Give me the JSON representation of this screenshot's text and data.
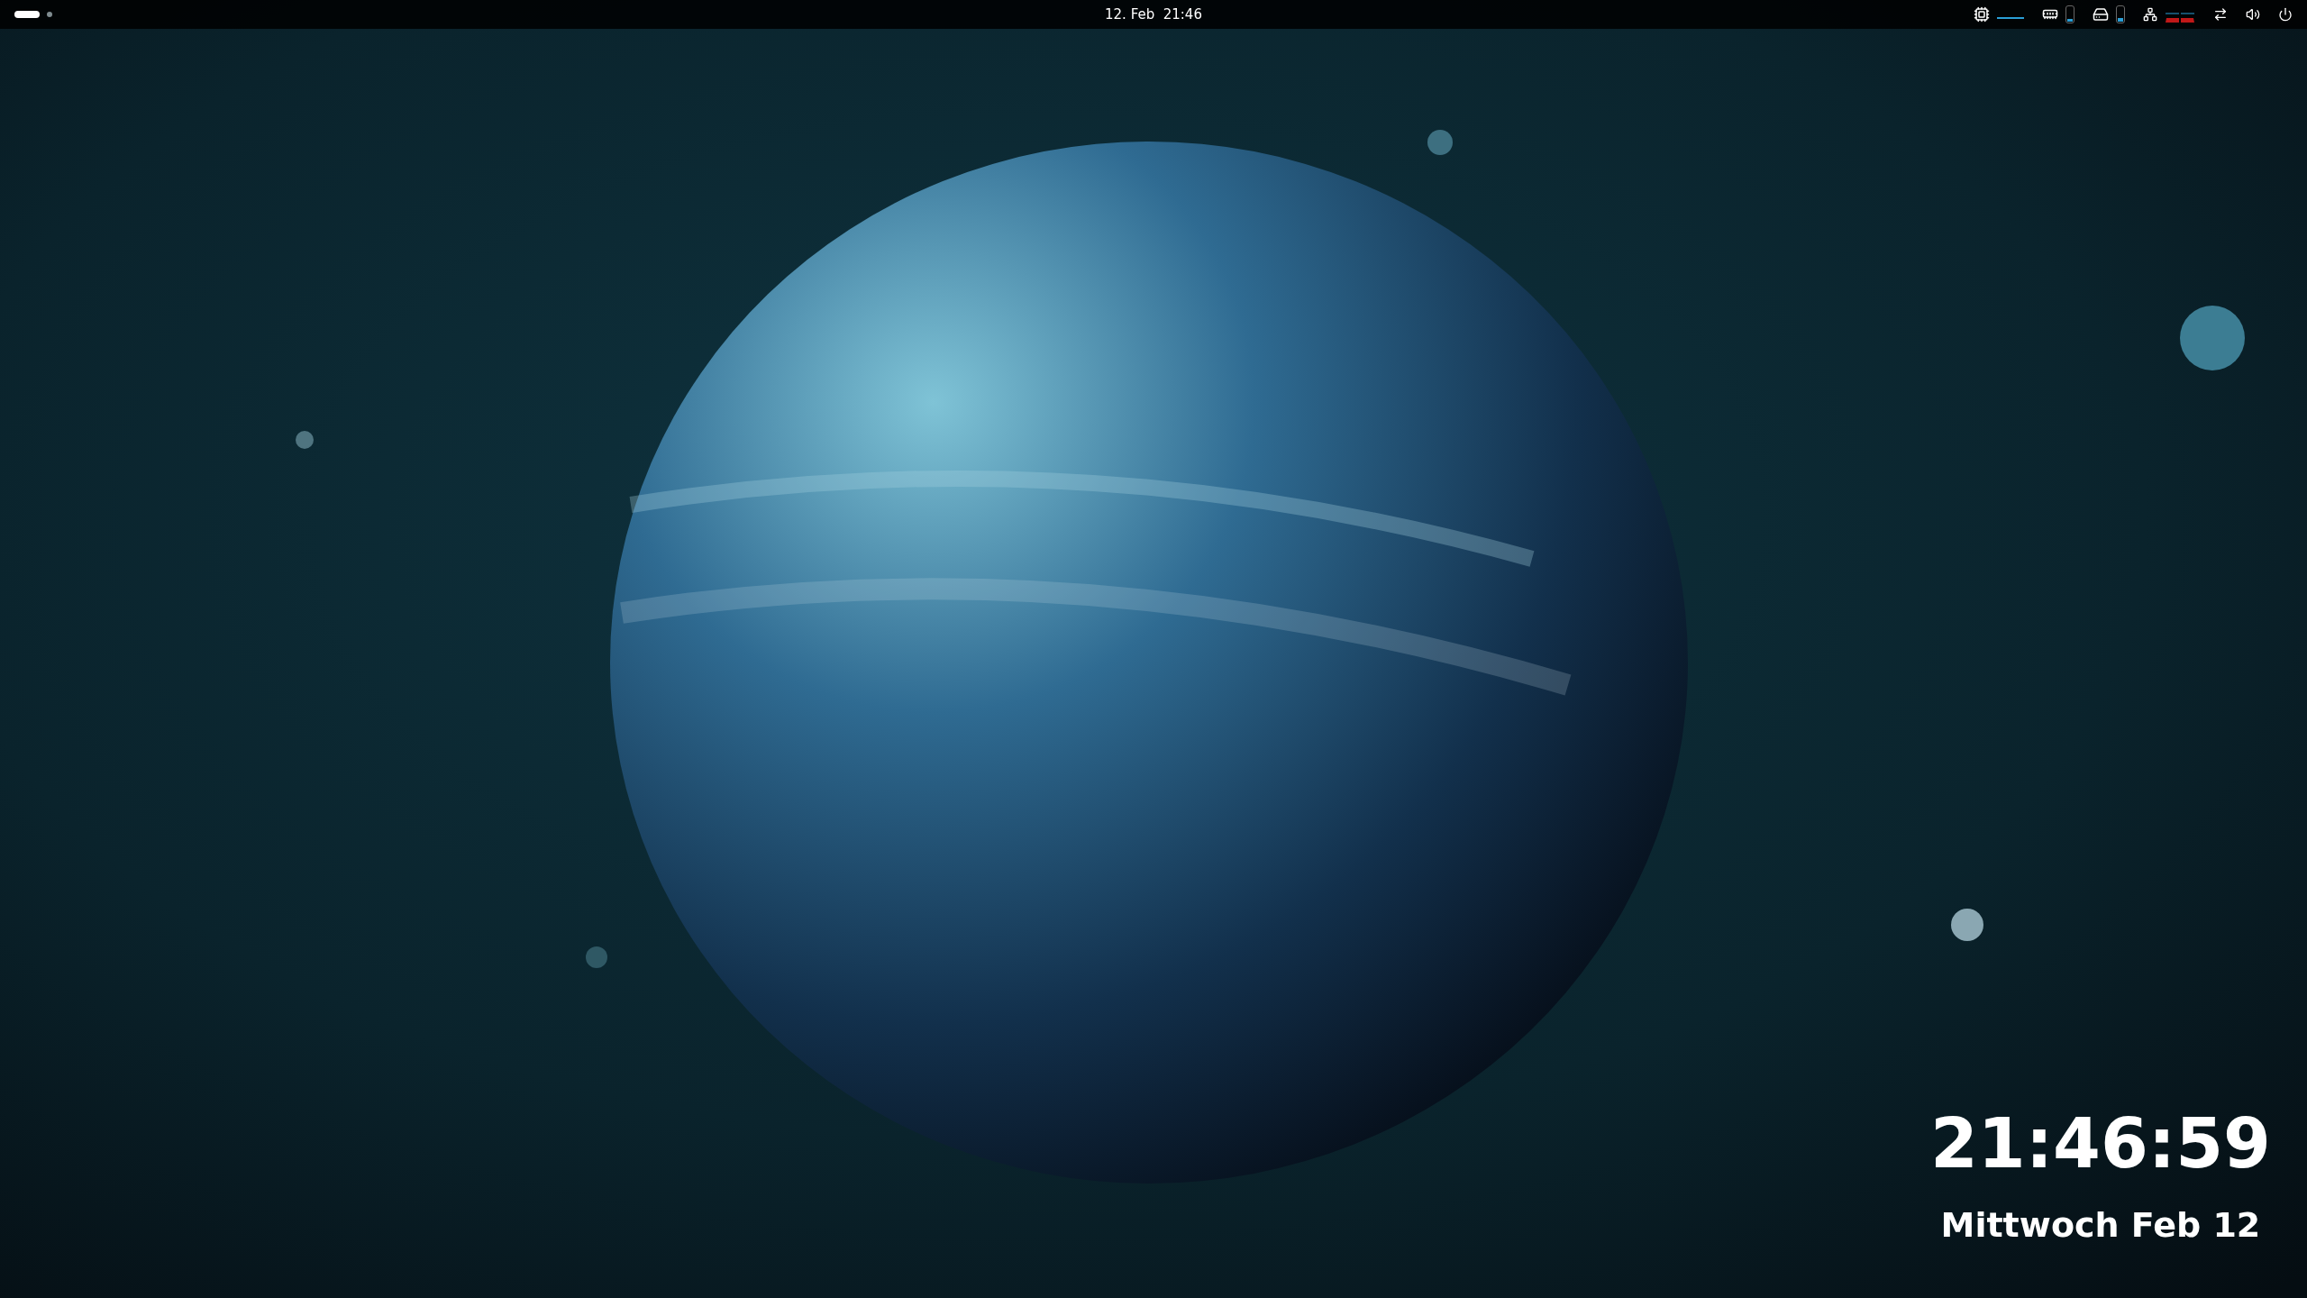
{
  "top_bar": {
    "workspaces": [
      {
        "selected": true
      },
      {
        "selected": false
      }
    ],
    "clock": "12. Feb  21:46",
    "monitors": [
      {
        "kind": "graph"
      },
      {
        "kind": "memory",
        "level": 0.2
      },
      {
        "kind": "disk",
        "level": 0.22
      },
      {
        "kind": "network"
      }
    ]
  },
  "desktop_clock": {
    "time": "21:46:59",
    "date": "Mittwoch Feb 12"
  }
}
